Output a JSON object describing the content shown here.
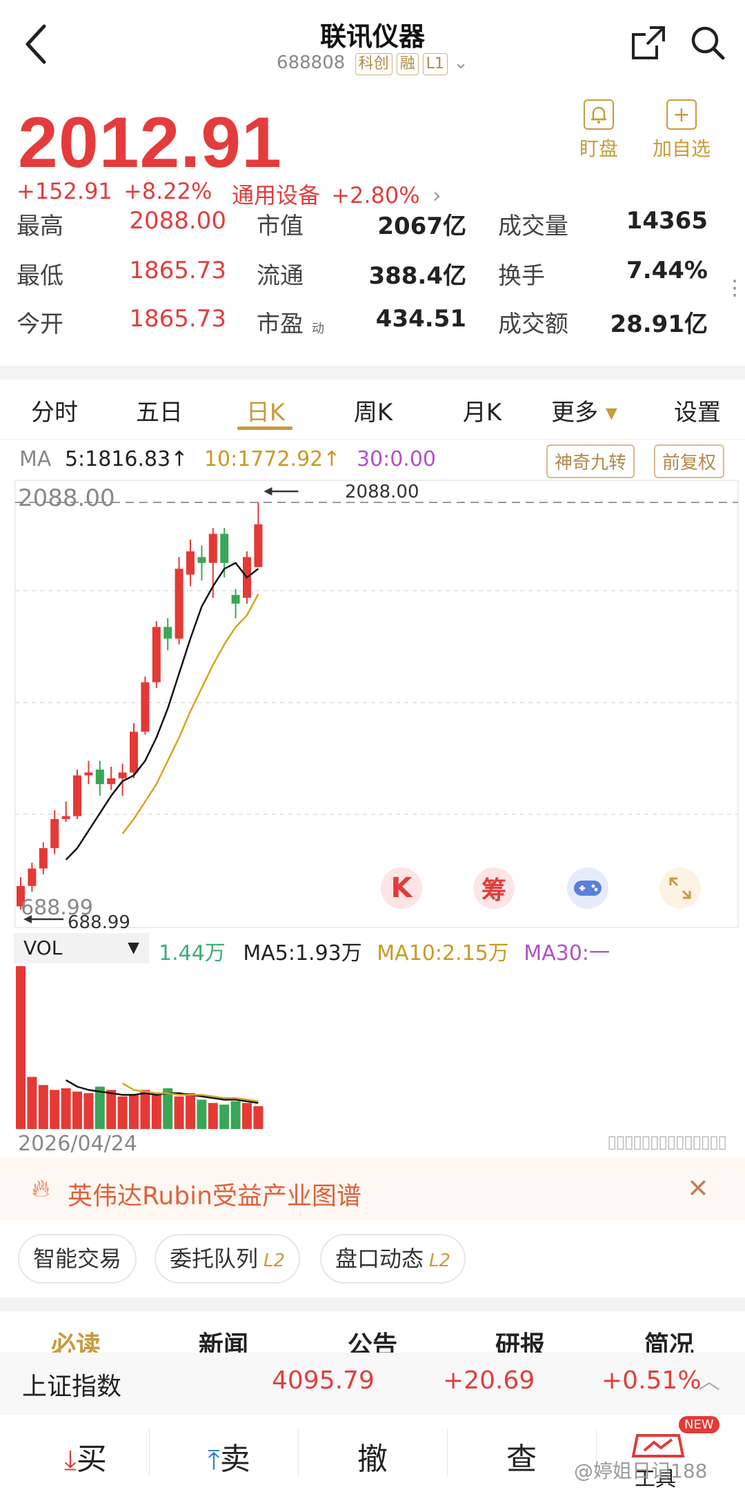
{
  "header": {
    "title": "联讯仪器",
    "code": "688808",
    "tags": [
      "科创",
      "融",
      "L1"
    ]
  },
  "quote": {
    "price": "2012.91",
    "change": "+152.91",
    "change_pct": "+8.22%",
    "sector": "通用设备",
    "sector_pct": "+2.80%"
  },
  "actions": {
    "watch_label": "盯盘",
    "add_label": "加自选"
  },
  "stats": [
    {
      "label": "最高",
      "value": "2088.00",
      "color": "red"
    },
    {
      "label": "市值",
      "value": "2067亿",
      "color": "dark"
    },
    {
      "label": "成交量",
      "value": "14365",
      "color": "dark"
    },
    {
      "label": "最低",
      "value": "1865.73",
      "color": "red"
    },
    {
      "label": "流通",
      "value": "388.4亿",
      "color": "dark"
    },
    {
      "label": "换手",
      "value": "7.44%",
      "color": "dark"
    },
    {
      "label": "今开",
      "value": "1865.73",
      "color": "red"
    },
    {
      "label": "市盈",
      "value": "434.51",
      "color": "dark"
    },
    {
      "label": "成交额",
      "value": "28.91亿",
      "color": "dark"
    }
  ],
  "pe_sup": "动",
  "tabs": [
    "分时",
    "五日",
    "日K",
    "周K",
    "月K",
    "更多",
    "设置"
  ],
  "ma": {
    "label": "MA",
    "ma5": "5:1816.83",
    "ma10": "10:1772.92",
    "ma30": "30:0.00",
    "btn1": "神奇九转",
    "btn2": "前复权"
  },
  "chart_labels": {
    "high_axis": "2088.00",
    "high_marker": "2088.00",
    "low_axis": "688.99",
    "low_marker": "688.99",
    "date": "2026/04/24"
  },
  "float_buttons": [
    "K",
    "筹"
  ],
  "vol": {
    "label": "VOL",
    "current": "1.44万",
    "ma5": "MA5:1.93万",
    "ma10": "MA10:2.15万",
    "ma30": "MA30:一"
  },
  "banner": {
    "text": "英伟达Rubin受益产业图谱"
  },
  "chips": [
    {
      "label": "智能交易",
      "badge": ""
    },
    {
      "label": "委托队列",
      "badge": "L2"
    },
    {
      "label": "盘口动态",
      "badge": "L2"
    }
  ],
  "read_tabs": [
    "必读",
    "新闻",
    "公告",
    "研报",
    "简况"
  ],
  "index_bar": {
    "name": "上证指数",
    "value": "4095.79",
    "change": "+20.69",
    "pct": "+0.51%"
  },
  "bottom": {
    "buy": "买",
    "sell": "卖",
    "cancel": "撤",
    "query": "查",
    "tool": "工具",
    "new_badge": "NEW"
  },
  "watermark": "@婷姐日记188",
  "chart_data": {
    "type": "candlestick",
    "ylim": [
      688.99,
      2088.0
    ],
    "candles": [
      {
        "o": 700,
        "c": 770,
        "h": 800,
        "l": 689
      },
      {
        "o": 770,
        "c": 830,
        "h": 850,
        "l": 750
      },
      {
        "o": 830,
        "c": 900,
        "h": 920,
        "l": 810
      },
      {
        "o": 900,
        "c": 1000,
        "h": 1030,
        "l": 880
      },
      {
        "o": 1000,
        "c": 1010,
        "h": 1060,
        "l": 990
      },
      {
        "o": 1010,
        "c": 1150,
        "h": 1170,
        "l": 1000
      },
      {
        "o": 1150,
        "c": 1160,
        "h": 1200,
        "l": 1120
      },
      {
        "o": 1170,
        "c": 1120,
        "h": 1200,
        "l": 1080
      },
      {
        "o": 1120,
        "c": 1140,
        "h": 1180,
        "l": 1100
      },
      {
        "o": 1140,
        "c": 1160,
        "h": 1190,
        "l": 1080
      },
      {
        "o": 1160,
        "c": 1300,
        "h": 1330,
        "l": 1140
      },
      {
        "o": 1300,
        "c": 1470,
        "h": 1490,
        "l": 1290
      },
      {
        "o": 1470,
        "c": 1660,
        "h": 1680,
        "l": 1450
      },
      {
        "o": 1660,
        "c": 1620,
        "h": 1690,
        "l": 1580
      },
      {
        "o": 1620,
        "c": 1860,
        "h": 1900,
        "l": 1600
      },
      {
        "o": 1840,
        "c": 1920,
        "h": 1960,
        "l": 1800
      },
      {
        "o": 1900,
        "c": 1880,
        "h": 1940,
        "l": 1820
      },
      {
        "o": 1880,
        "c": 1980,
        "h": 2000,
        "l": 1760
      },
      {
        "o": 1980,
        "c": 1880,
        "h": 2000,
        "l": 1830
      },
      {
        "o": 1770,
        "c": 1740,
        "h": 1790,
        "l": 1690
      },
      {
        "o": 1760,
        "c": 1900,
        "h": 1920,
        "l": 1740
      },
      {
        "o": 1865.73,
        "c": 2012.91,
        "h": 2088.0,
        "l": 1865.73
      }
    ],
    "ma5": [
      null,
      null,
      null,
      null,
      860,
      900,
      960,
      1020,
      1080,
      1130,
      1150,
      1200,
      1280,
      1380,
      1500,
      1620,
      1730,
      1800,
      1860,
      1880,
      1830,
      1860
    ],
    "ma10": [
      null,
      null,
      null,
      null,
      null,
      null,
      null,
      null,
      null,
      950,
      1000,
      1060,
      1120,
      1200,
      1280,
      1370,
      1450,
      1530,
      1600,
      1660,
      1700,
      1772.92
    ],
    "volume": [
      100,
      32,
      27,
      24,
      25,
      23,
      22,
      26,
      24,
      20,
      21,
      24,
      21,
      25,
      20,
      22,
      18,
      16,
      15,
      17,
      16,
      14
    ],
    "vol_ma5": [
      null,
      null,
      null,
      null,
      30,
      26,
      24,
      23,
      22,
      21,
      21,
      22,
      21,
      22,
      22,
      21,
      20,
      19,
      18,
      18,
      17,
      16
    ],
    "vol_ma10": [
      null,
      null,
      null,
      null,
      null,
      null,
      null,
      null,
      null,
      28,
      24,
      23,
      22,
      22,
      21,
      21,
      21,
      20,
      19,
      19,
      18,
      17
    ]
  }
}
